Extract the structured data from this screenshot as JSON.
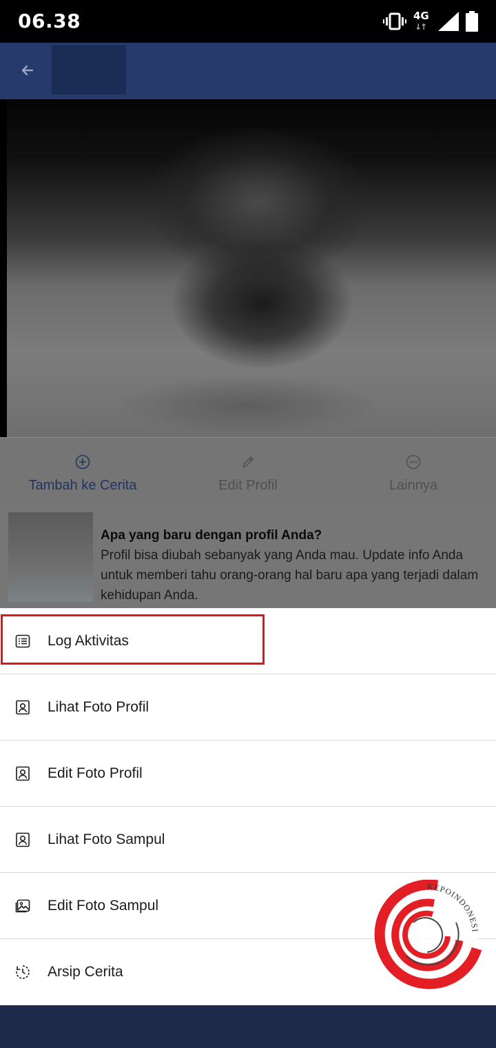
{
  "status_bar": {
    "time": "06.38",
    "network_label": "4G",
    "icons": [
      "vibrate-icon",
      "network-4g-icon",
      "signal-icon",
      "battery-icon"
    ]
  },
  "top_bar": {
    "back_icon": "arrow-left-icon"
  },
  "profile_actions": [
    {
      "label": "Tambah ke Cerita",
      "icon": "plus-circle-icon"
    },
    {
      "label": "Edit Profil",
      "icon": "pencil-icon"
    },
    {
      "label": "Lainnya",
      "icon": "more-circle-icon"
    }
  ],
  "prompt_card": {
    "title": "Apa yang baru dengan profil Anda?",
    "body": "Profil bisa diubah sebanyak yang Anda mau. Update info Anda untuk memberi tahu orang-orang hal baru apa yang terjadi dalam kehidupan Anda."
  },
  "menu": {
    "items": [
      {
        "label": "Log Aktivitas",
        "icon": "list-icon",
        "highlighted": true
      },
      {
        "label": "Lihat Foto Profil",
        "icon": "profile-photo-icon"
      },
      {
        "label": "Edit Foto Profil",
        "icon": "profile-photo-icon"
      },
      {
        "label": "Lihat Foto Sampul",
        "icon": "profile-photo-icon"
      },
      {
        "label": "Edit Foto Sampul",
        "icon": "image-icon"
      },
      {
        "label": "Arsip Cerita",
        "icon": "story-archive-icon"
      }
    ]
  },
  "watermark": {
    "text": "KEPOINDONESIA"
  },
  "colors": {
    "top_bar": "#263a6b",
    "highlight": "#e0141b",
    "bottom_nav": "#1f2a4b",
    "watermark": "#e31e24"
  }
}
